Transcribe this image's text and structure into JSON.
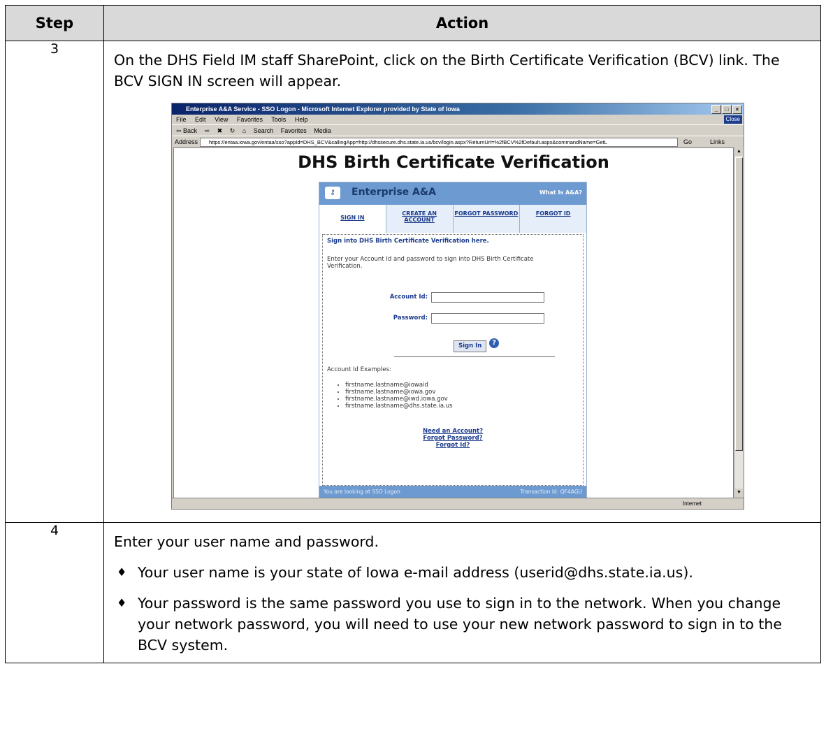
{
  "table": {
    "headers": {
      "step": "Step",
      "action": "Action"
    },
    "rows": [
      {
        "step": "3",
        "text": "On the DHS Field IM staff SharePoint, click on the Birth Certificate Verification (BCV) link.  The BCV SIGN IN screen will appear."
      },
      {
        "step": "4",
        "text": "Enter your user name and password.",
        "bullets": [
          "Your user name is your state of Iowa e-mail address (userid@dhs.state.ia.us).",
          "Your password is the same password you use to sign in to the network.  When you change your network password, you will need to use your new network password to sign in to the BCV system."
        ]
      }
    ]
  },
  "screenshot": {
    "window_title": "Enterprise A&A Service - SSO Logon - Microsoft Internet Explorer provided by State of Iowa",
    "title_buttons": [
      "_",
      "□",
      "×"
    ],
    "menu": [
      "File",
      "Edit",
      "View",
      "Favorites",
      "Tools",
      "Help"
    ],
    "close_label": "Close",
    "toolbar": [
      "⇦ Back",
      "⇨",
      "✖",
      "↻",
      "⌂",
      "Search",
      "Favorites",
      "Media"
    ],
    "address_label": "Address",
    "address_value": "https://entaa.iowa.gov/entaa/sso?appId=DHS_BCV&callingApp=http://dhssecure.dhs.state.ia.us/bcv/login.aspx?ReturnUrl=%2fBCV%2fDefault.aspx&commandName=GetL",
    "go_label": "Go",
    "links_label": "Links",
    "page_title": "DHS Birth Certificate Verification",
    "aa": {
      "brand": "Enterprise A&A",
      "what_is": "What Is A&A?",
      "tabs": [
        "SIGN IN",
        "CREATE AN ACCOUNT",
        "FORGOT PASSWORD",
        "FORGOT ID"
      ],
      "heading": "Sign into DHS Birth Certificate Verification here.",
      "intro": "Enter your Account Id and password to sign into DHS Birth Certificate Verification.",
      "account_label": "Account Id:",
      "password_label": "Password:",
      "sign_in": "Sign In",
      "examples_label": "Account Id Examples:",
      "examples": [
        "firstname.lastname@iowaid",
        "firstname.lastname@iowa.gov",
        "firstname.lastname@iwd.iowa.gov",
        "firstname.lastname@dhs.state.ia.us"
      ],
      "links": [
        "Need an Account?",
        "Forgot Password?",
        "Forgot Id?"
      ],
      "footer_left": "You are looking at SSO Logon",
      "footer_right": "Transaction Id:  QF4AGU"
    },
    "status_zone": "Internet"
  }
}
